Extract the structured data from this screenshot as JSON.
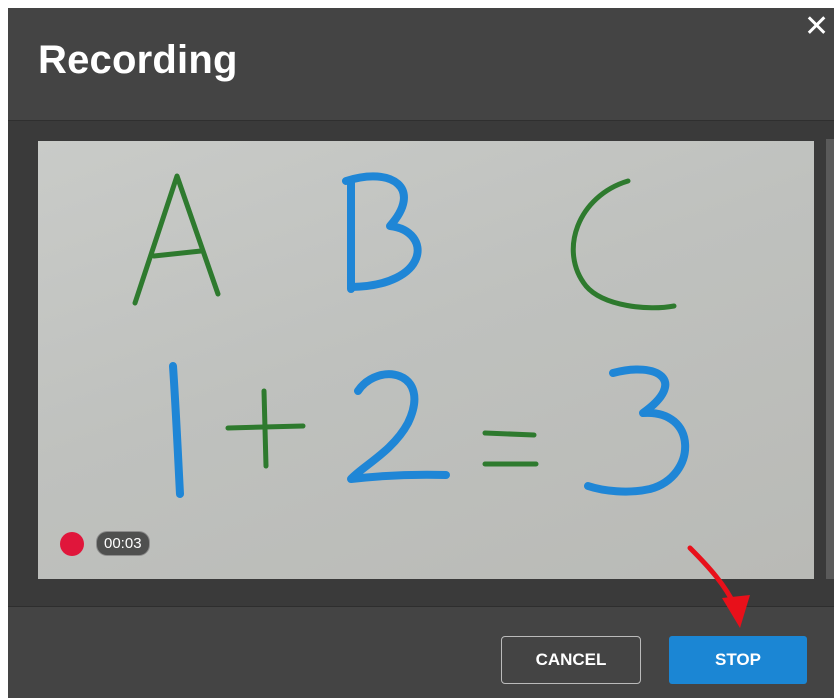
{
  "dialog": {
    "title": "Recording",
    "close_glyph": "✕",
    "close_icon": "close-icon"
  },
  "preview": {
    "content": "camera-feed-whiteboard",
    "recording_dot_color": "#e0163b",
    "timer": "00:03"
  },
  "footer": {
    "cancel_label": "CANCEL",
    "stop_label": "STOP",
    "stop_color": "#1b86d4"
  },
  "annotation": {
    "arrow_color": "#e8101a",
    "icon": "red-arrow-icon"
  }
}
